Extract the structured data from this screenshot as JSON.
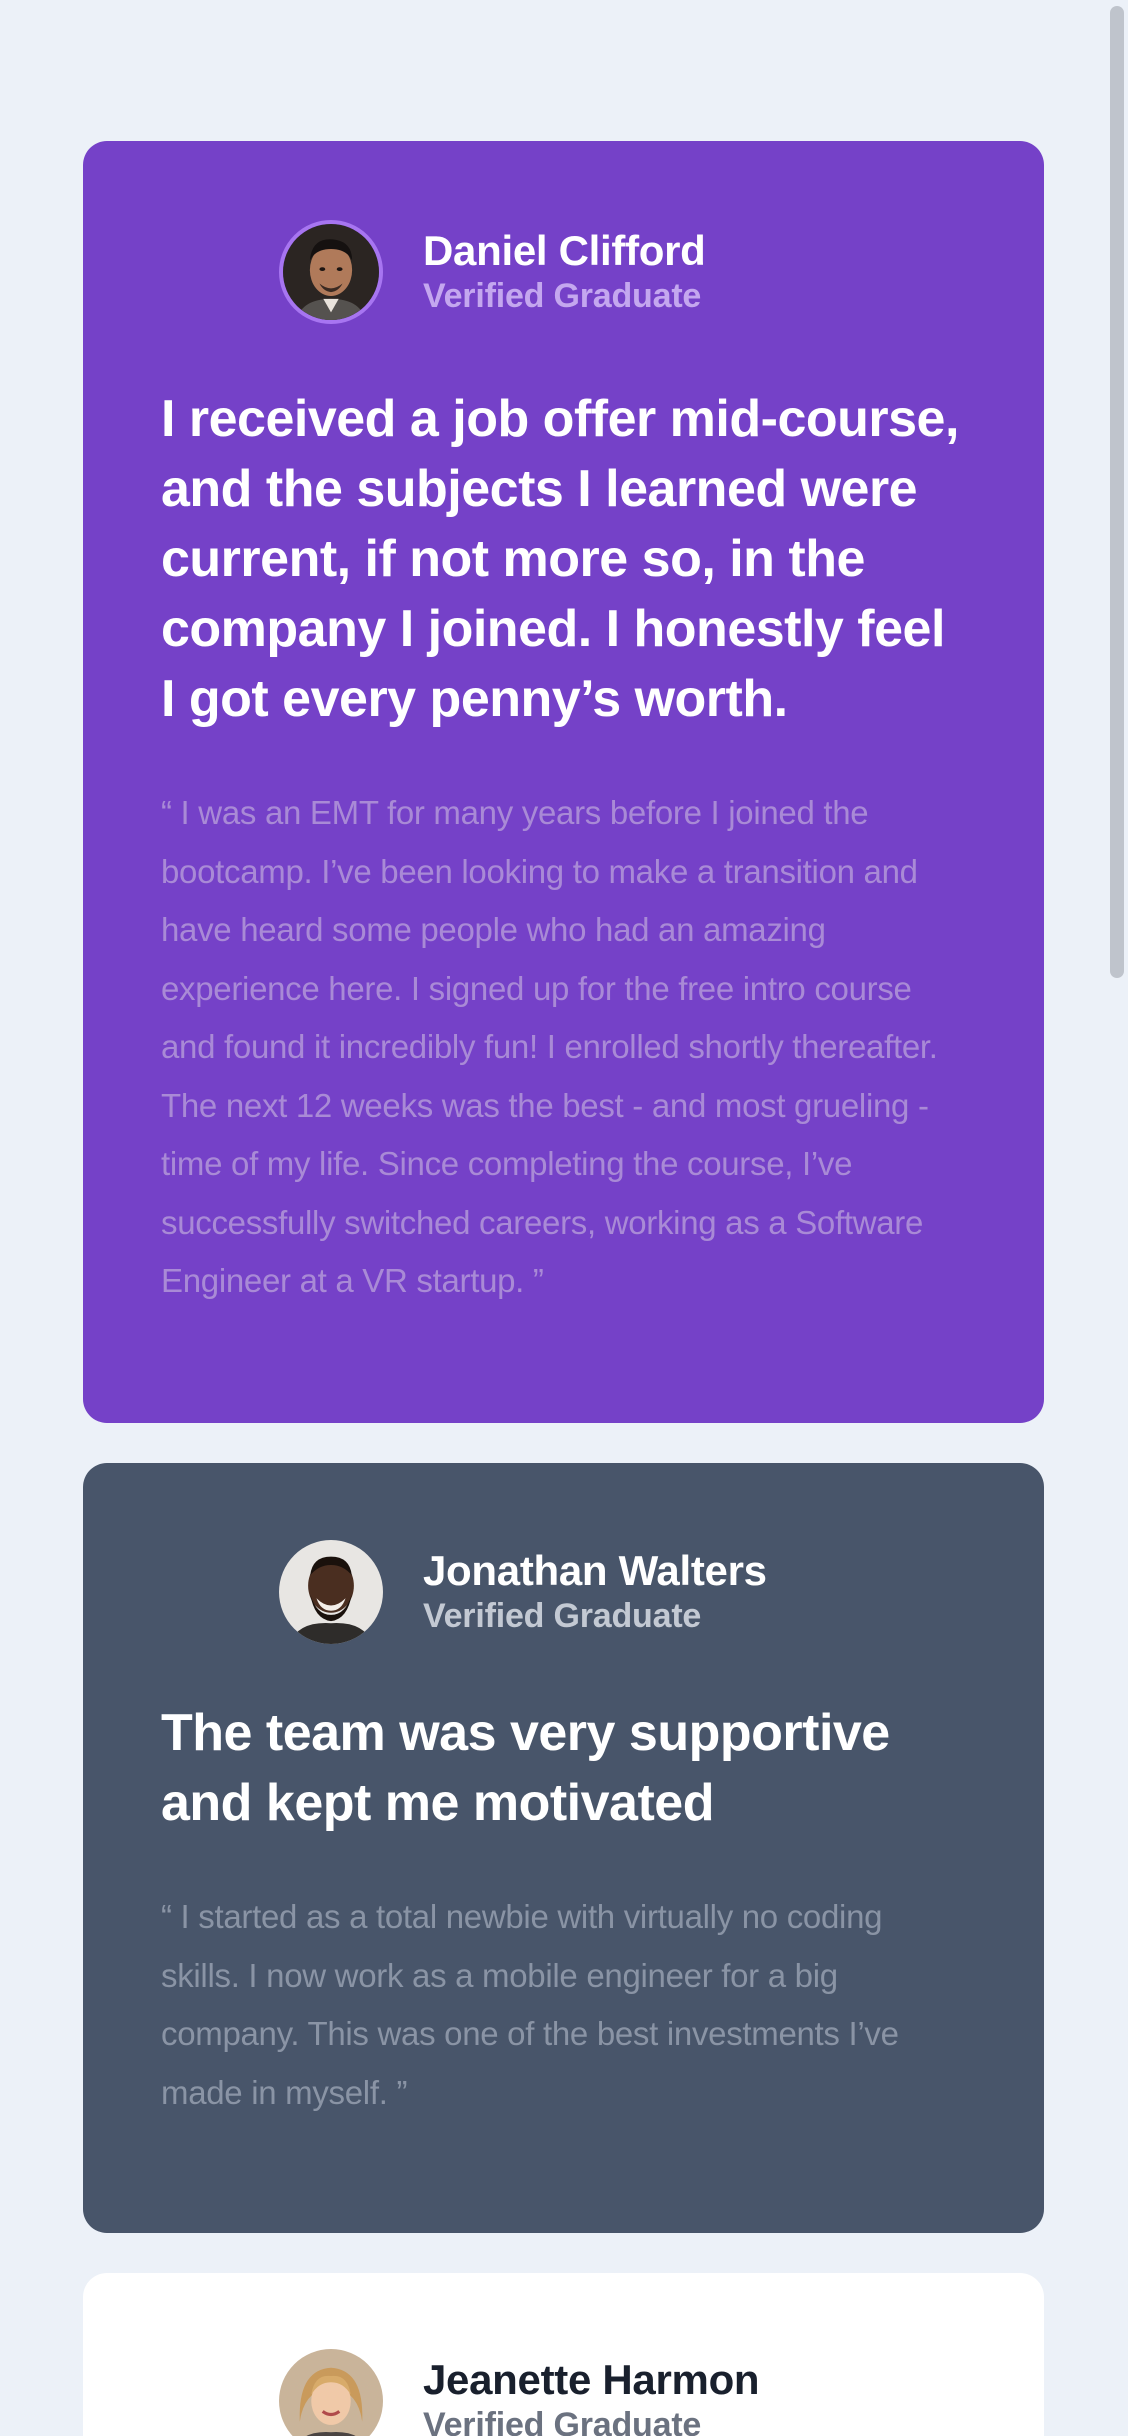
{
  "testimonials": [
    {
      "name": "Daniel Clifford",
      "role": "Verified Graduate",
      "avatar": "portrait-daniel",
      "headline": "I received a job offer mid-course, and the subjects I learned were current, if not more so, in the company I joined. I honestly feel I got every penny’s worth.",
      "quote": "“ I was an EMT for many years before I joined the bootcamp. I’ve been looking to make a transition and have heard some people who had an amazing experience here. I signed up for the free intro course and found it incredibly fun! I enrolled shortly thereafter. The next 12 weeks was the best - and most grueling - time of my life. Since completing the course, I’ve successfully switched careers, working as a Software Engineer at a VR startup. ”"
    },
    {
      "name": "Jonathan Walters",
      "role": "Verified Graduate",
      "avatar": "portrait-jonathan",
      "headline": "The team was very supportive and kept me motivated",
      "quote": "“ I started as a total newbie with virtually no coding skills. I now work as a mobile engineer for a big company. This was one of the best investments I’ve made in myself. ”"
    },
    {
      "name": "Jeanette Harmon",
      "role": "Verified Graduate",
      "avatar": "portrait-jeanette"
    }
  ],
  "colors": {
    "background": "#ecf1f8",
    "purple_card": "#7541c8",
    "slate_card": "#48556a",
    "white_card": "#ffffff"
  }
}
